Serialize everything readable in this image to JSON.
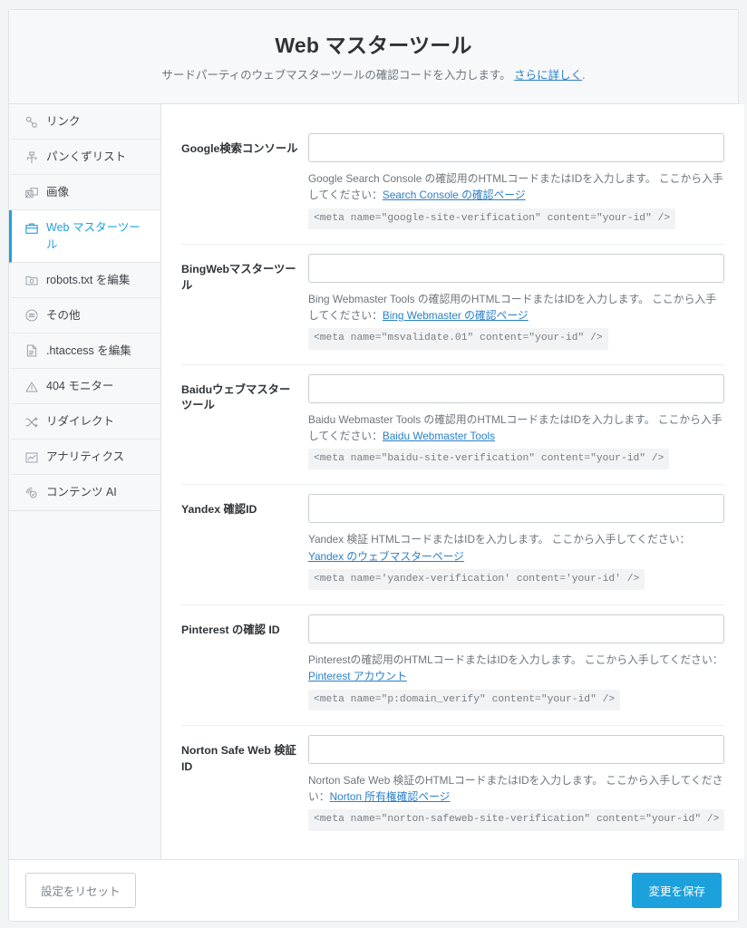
{
  "header": {
    "title": "Web マスターツール",
    "subtitle_before": "サードパーティのウェブマスターツールの確認コードを入力します。",
    "subtitle_link": "さらに詳しく",
    "subtitle_after": "."
  },
  "colors": {
    "accent": "#21a0dd",
    "save_button": "#1da1dd",
    "link": "#2a7fc9",
    "page_background": "#f3f4f6",
    "header_background": "#f7f8f9",
    "code_background": "#f2f3f4",
    "border": "#dfe2e6"
  },
  "sidebar": {
    "items": [
      {
        "label": "リンク",
        "icon": "link-icon",
        "active": false
      },
      {
        "label": "パンくずリスト",
        "icon": "breadcrumb-icon",
        "active": false
      },
      {
        "label": "画像",
        "icon": "image-icon",
        "active": false
      },
      {
        "label": "Web マスターツール",
        "icon": "briefcase-icon",
        "active": true
      },
      {
        "label": "robots.txt を編集",
        "icon": "robot-file-icon",
        "active": false
      },
      {
        "label": "その他",
        "icon": "list-circle-icon",
        "active": false
      },
      {
        "label": ".htaccess を編集",
        "icon": "document-icon",
        "active": false
      },
      {
        "label": "404 モニター",
        "icon": "warning-triangle-icon",
        "active": false
      },
      {
        "label": "リダイレクト",
        "icon": "shuffle-icon",
        "active": false
      },
      {
        "label": "アナリティクス",
        "icon": "chart-icon",
        "active": false
      },
      {
        "label": "コンテンツ AI",
        "icon": "content-ai-icon",
        "active": false
      }
    ]
  },
  "fields": [
    {
      "label": "Google検索コンソール",
      "value": "",
      "placeholder": "",
      "help_before": "Google Search Console の確認用のHTMLコードまたはIDを入力します。 ここから入手してください：",
      "help_link": "Search Console の確認ページ",
      "code": "<meta name=\"google-site-verification\" content=\"your-id\" />"
    },
    {
      "label": "BingWebマスターツール",
      "value": "",
      "placeholder": "",
      "help_before": "Bing Webmaster Tools の確認用のHTMLコードまたはIDを入力します。 ここから入手してください：",
      "help_link": "Bing Webmaster の確認ページ",
      "code": "<meta name=\"msvalidate.01\" content=\"your-id\" />"
    },
    {
      "label": "Baiduウェブマスターツール",
      "value": "",
      "placeholder": "",
      "help_before": "Baidu Webmaster Tools の確認用のHTMLコードまたはIDを入力します。 ここから入手してください：",
      "help_link": "Baidu Webmaster Tools",
      "code": "<meta name=\"baidu-site-verification\" content=\"your-id\" />"
    },
    {
      "label": "Yandex 確認ID",
      "value": "",
      "placeholder": "",
      "help_before": "Yandex 検証 HTMLコードまたはIDを入力します。 ここから入手してください：",
      "help_link": "Yandex のウェブマスターページ",
      "code": "<meta name='yandex-verification' content='your-id' />"
    },
    {
      "label": "Pinterest の確認 ID",
      "value": "",
      "placeholder": "",
      "help_before": "Pinterestの確認用のHTMLコードまたはIDを入力します。 ここから入手してください：",
      "help_link": "Pinterest アカウント",
      "code": "<meta name=\"p:domain_verify\" content=\"your-id\" />"
    },
    {
      "label": "Norton Safe Web 検証ID",
      "value": "",
      "placeholder": "",
      "help_before": "Norton Safe Web 検証のHTMLコードまたはIDを入力します。 ここから入手してください：",
      "help_link": "Norton 所有権確認ページ",
      "code": "<meta name=\"norton-safeweb-site-verification\" content=\"your-id\" />"
    }
  ],
  "footer": {
    "reset_label": "設定をリセット",
    "save_label": "変更を保存"
  }
}
